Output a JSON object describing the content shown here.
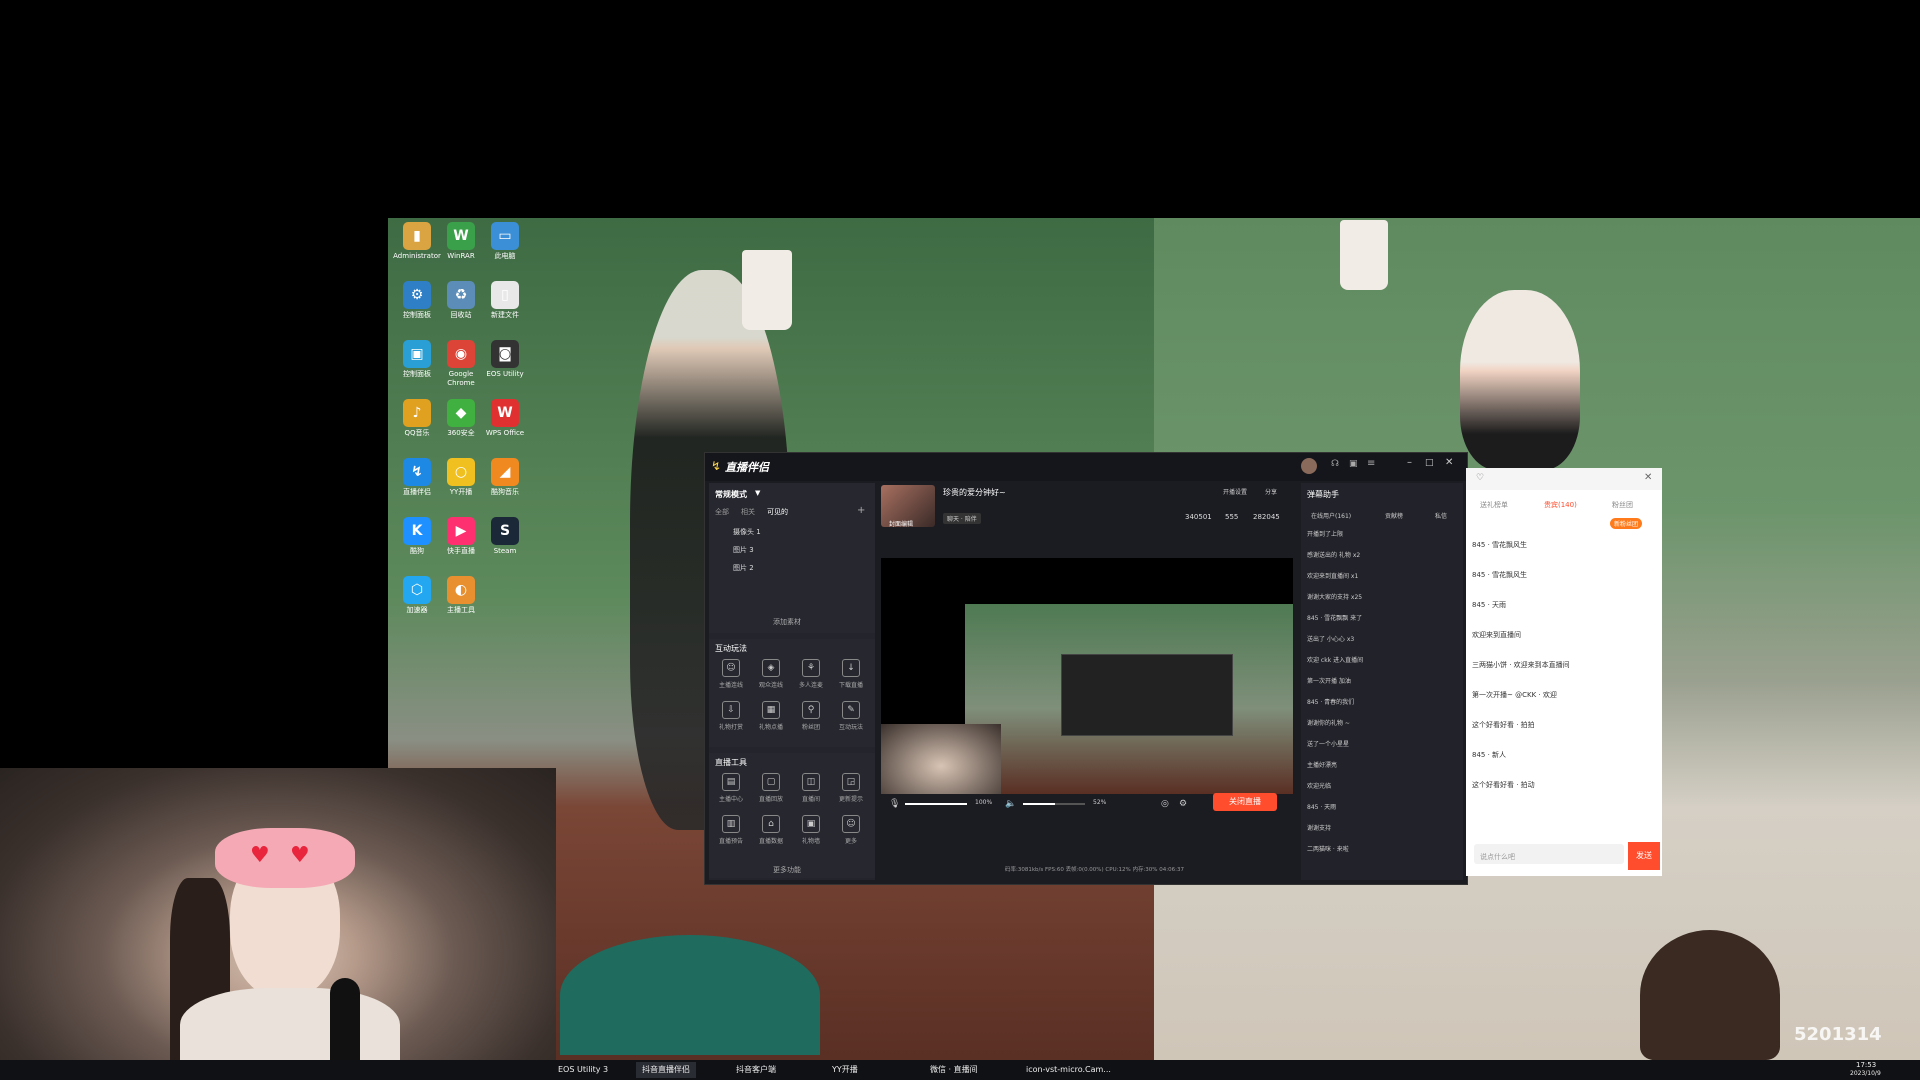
{
  "desktop_icons": [
    {
      "label": "Administrator",
      "color": "#d9a441",
      "glyph": "▮"
    },
    {
      "label": "WinRAR",
      "color": "#3aa04a",
      "glyph": "W"
    },
    {
      "label": "此电脑",
      "color": "#3a8fd6",
      "glyph": "▭"
    },
    {
      "label": "控制面板",
      "color": "#2f7fc7",
      "glyph": "⚙"
    },
    {
      "label": "回收站",
      "color": "#5b8db8",
      "glyph": "♻"
    },
    {
      "label": "新建文件",
      "color": "#e8e8e8",
      "glyph": "▯"
    },
    {
      "label": "控制面板",
      "color": "#2a9fd6",
      "glyph": "▣"
    },
    {
      "label": "Google Chrome",
      "color": "#db4437",
      "glyph": "◉"
    },
    {
      "label": "EOS Utility",
      "color": "#333",
      "glyph": "◙"
    },
    {
      "label": "QQ音乐",
      "color": "#e0a020",
      "glyph": "♪"
    },
    {
      "label": "360安全",
      "color": "#40b040",
      "glyph": "◆"
    },
    {
      "label": "WPS Office",
      "color": "#e03030",
      "glyph": "W"
    },
    {
      "label": "直播伴侣",
      "color": "#1e88e5",
      "glyph": "↯"
    },
    {
      "label": "YY开播",
      "color": "#f0c020",
      "glyph": "○"
    },
    {
      "label": "酷狗音乐",
      "color": "#f08a20",
      "glyph": "◢"
    },
    {
      "label": "酷狗",
      "color": "#1e90ff",
      "glyph": "K"
    },
    {
      "label": "快手直播",
      "color": "#ff3070",
      "glyph": "▶"
    },
    {
      "label": "Steam",
      "color": "#1b2838",
      "glyph": "S"
    },
    {
      "label": "加速器",
      "color": "#22a7f0",
      "glyph": "⬡"
    },
    {
      "label": "主播工具",
      "color": "#e89030",
      "glyph": "◐"
    }
  ],
  "webcam": {
    "alt": "webcam"
  },
  "app": {
    "title": "直播伴侣",
    "mode_label": "常规模式",
    "tabs": [
      "全部",
      "相关",
      "可见的"
    ],
    "scenes": [
      "摄像头 1",
      "图片 3",
      "图片 2"
    ],
    "add_material": "添加素材",
    "interactive_title": "互动玩法",
    "tools_title": "直播工具",
    "interactive_tools": [
      "主播连线",
      "观众连线",
      "多人连麦",
      "下载直播",
      "礼物打赏",
      "礼物点播",
      "粉丝团",
      "互动玩法"
    ],
    "live_tools": [
      "主播中心",
      "直播回放",
      "直播间",
      "更新提示",
      "直播预告",
      "直播数据",
      "礼物墙",
      "更多"
    ],
    "more": "更多功能",
    "stream_title": "珍贵的爱分钟好~",
    "cover_label": "封面编辑",
    "tag_label": "聊天 · 陪伴",
    "stats": {
      "likes": "340501",
      "viewers": "555",
      "hearts": "282045"
    },
    "top_actions": [
      "开播设置",
      "分享"
    ],
    "mic_volume": "100%",
    "speaker_volume": "52%",
    "mic_level": 1.0,
    "speaker_level": 0.52,
    "end_button": "关闭直播",
    "status_bar": "码率:3081kb/s   FPS:60   丢帧:0(0.00%)   CPU:12%   内存:30%   04:06:37"
  },
  "chat": {
    "title": "弹幕助手",
    "tabs": [
      "在线用户(161)",
      "贡献榜",
      "私信"
    ],
    "lines": [
      "开播到了上限",
      "感谢送出的 礼物 x2",
      "欢迎来到直播间 x1",
      "谢谢大家的支持 x25",
      "845 · 雪花飘飘 来了",
      "送出了 小心心 x3",
      "欢迎 ckk 进入直播间",
      "第一次开播 加油",
      "845 · 青春的我们",
      "谢谢你的礼物 ~",
      "送了一个小星星",
      "主播好漂亮",
      "欢迎光临",
      "845 · 天雨",
      "谢谢支持",
      "二两猫咪 · 来啦"
    ]
  },
  "side": {
    "tabs": [
      "送礼榜单",
      "贵宾(140)",
      "粉丝团"
    ],
    "lines": [
      "845 · 雪花飘风生",
      "845 · 雪花飘风生",
      "845 · 天雨",
      "欢迎来到直播间",
      "三两猫小饼 · 欢迎来到本直播间",
      "第一次开播~ @CKK · 欢迎",
      "这个好看好看 · 拍拍",
      "845 · 新人",
      "这个好看好看 · 拍动"
    ],
    "badge": "新粉丝团",
    "input_placeholder": "说点什么吧",
    "send_label": "发送"
  },
  "watermark": "5201314",
  "taskbar": {
    "items": [
      "EOS Utility 3",
      "抖音直播伴侣",
      "抖音客户端",
      "YY开播",
      "微信 · 直播间",
      "icon-vst-micro.Cam..."
    ],
    "time": "17:53",
    "date": "2023/10/9"
  }
}
